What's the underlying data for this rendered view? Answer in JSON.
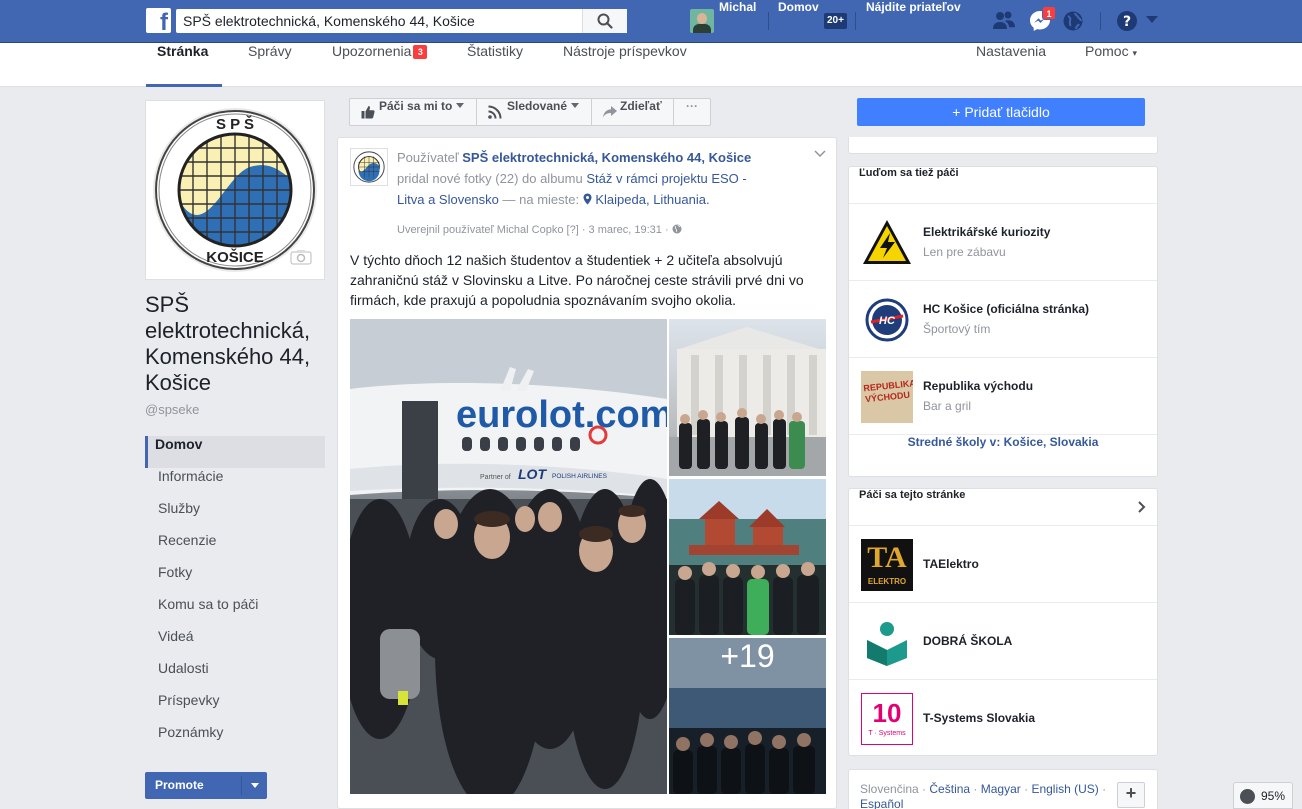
{
  "topbar": {
    "logo": "f",
    "search_value": "SPŠ elektrotechnická, Komenského 44, Košice",
    "user_name": "Michal",
    "home_label": "Domov",
    "home_count": "20+",
    "find_friends_label": "Nájdite priateľov",
    "messages_count": "1",
    "icons": [
      "friend-requests-icon",
      "messages-icon",
      "notifications-globe-icon",
      "help-icon",
      "account-menu-icon"
    ]
  },
  "page_nav": {
    "items": [
      {
        "label": "Stránka"
      },
      {
        "label": "Správy"
      },
      {
        "label": "Upozornenia"
      },
      {
        "label": "Štatistiky"
      },
      {
        "label": "Nástroje príspevkov"
      }
    ],
    "notifications_count": "3",
    "settings_label": "Nastavenia",
    "help_label": "Pomoc",
    "help_caret": "▾"
  },
  "profile": {
    "logo_top": "S P Š",
    "logo_bottom": "KOŠICE",
    "name": "SPŠ elektrotechnická, Komenského 44, Košice",
    "handle": "@spseke"
  },
  "side_nav": [
    {
      "label": "Domov"
    },
    {
      "label": "Informácie"
    },
    {
      "label": "Služby"
    },
    {
      "label": "Recenzie"
    },
    {
      "label": "Fotky"
    },
    {
      "label": "Komu sa to páči"
    },
    {
      "label": "Videá"
    },
    {
      "label": "Udalosti"
    },
    {
      "label": "Príspevky"
    },
    {
      "label": "Poznámky"
    }
  ],
  "promote_label": "Promote",
  "actions": {
    "like_label": "Páči sa mi to",
    "follow_label": "Sledované",
    "share_label": "Zdieľať",
    "more_label": "···",
    "add_button_label": "+ Pridať tlačidlo"
  },
  "post": {
    "prefix": "Používateľ",
    "page_name": "SPŠ elektrotechnická, Komenského 44, Košice",
    "action_text": "pridal nové fotky (22) do albumu",
    "album_name": "Stáž v rámci projektu ESO - Litva a Slovensko",
    "location_prefix": "— na mieste:",
    "location": "Klaipeda, Lithuania.",
    "meta_author": "Uverejnil používateľ Michal Copko",
    "meta_help": "[?]",
    "meta_date": "· 3 marec, 19:31 ·",
    "text": "V týchto dňoch 12 našich študentov a študentiek + 2 učiteľa absolvujú zahraničnú stáž v Slovinsku a Litve. Po náročnej ceste strávili prvé dni vo firmách, kde praxujú a popoludnia spoznávaním svojho okolia.",
    "photo_plane_text": "eurolot.com",
    "photo_plane_partner": "Partner of",
    "photo_plane_airline": "LOT",
    "photo_plane_airline_sub": "POLISH AIRLINES",
    "more_photos": "+19"
  },
  "also_liked": {
    "title": "Ľuďom sa tiež páči",
    "items": [
      {
        "name": "Elektrikářské kuriozity",
        "sub": "Len pre zábavu"
      },
      {
        "name": "HC Košice (oficiálna stránka)",
        "sub": "Športový tím"
      },
      {
        "name": "Republika východu",
        "sub": "Bar a gril",
        "thumb_text": "REPUBLIKA VÝCHODU"
      }
    ],
    "footer_link": "Stredné školy v: Košice, Slovakia"
  },
  "liked_by_page": {
    "title": "Páči sa tejto stránke",
    "items": [
      {
        "name": "TAElektro",
        "thumb_text": "TA",
        "thumb_sub": "ELEKTRO"
      },
      {
        "name": "DOBRÁ ŠKOLA"
      },
      {
        "name": "T-Systems Slovakia",
        "thumb_text": "10",
        "thumb_sub": "T · Systems"
      }
    ]
  },
  "languages": {
    "items": [
      "Slovenčina",
      "Čeština",
      "Magyar",
      "English (US)",
      "Español"
    ],
    "sep": " · ",
    "add_label": "+"
  },
  "zoom": "95%"
}
